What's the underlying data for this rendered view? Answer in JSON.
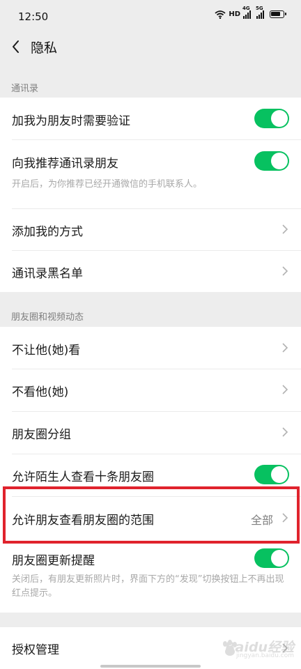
{
  "status": {
    "time": "12:50",
    "network": "HD",
    "sim1": "4G",
    "sim2": "5G"
  },
  "nav": {
    "title": "隐私"
  },
  "sections": {
    "contacts": {
      "label": "通讯录",
      "items": [
        {
          "label": "加我为朋友时需要验证",
          "toggle": true
        },
        {
          "label": "向我推荐通讯录朋友",
          "toggle": true,
          "desc": "开启后，为你推荐已经开通微信的手机联系人。"
        },
        {
          "label": "添加我的方式"
        },
        {
          "label": "通讯录黑名单"
        }
      ]
    },
    "moments": {
      "label": "朋友圈和视频动态",
      "items": [
        {
          "label": "不让他(她)看"
        },
        {
          "label": "不看他(她)"
        },
        {
          "label": "朋友圈分组"
        },
        {
          "label": "允许陌生人查看十条朋友圈",
          "toggle": true
        },
        {
          "label": "允许朋友查看朋友圈的范围",
          "value": "全部"
        },
        {
          "label": "朋友圈更新提醒",
          "toggle": true,
          "desc": "关闭后，有朋友更新照片时，界面下方的“发现”切换按钮上不再出现红点提示。"
        }
      ]
    },
    "other": {
      "items": [
        {
          "label": "授权管理"
        }
      ]
    }
  },
  "watermark": {
    "brand": "Baidu经验",
    "url": "jingyan.baidu.com"
  },
  "colors": {
    "toggle_on": "#07c160",
    "highlight": "#e0232d",
    "background": "#ededed"
  }
}
